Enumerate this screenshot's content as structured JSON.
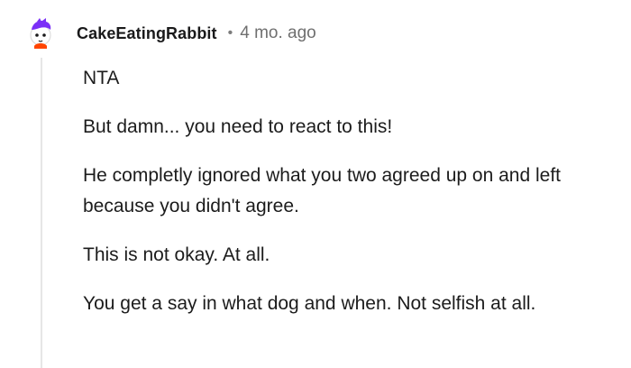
{
  "comment": {
    "username": "CakeEatingRabbit",
    "separator": "•",
    "timestamp": "4 mo. ago",
    "paragraphs": [
      "NTA",
      "But damn... you need to react to this!",
      "He completly ignored what you two agreed up on and left because you didn't agree.",
      "This is not okay. At all.",
      "You get a say in what dog and when. Not selfish at all."
    ]
  },
  "colors": {
    "avatar_hair": "#7b2ff7",
    "avatar_accent": "#ff4500",
    "thread_line": "#e6e6e6",
    "meta_text": "#6f6f6f"
  }
}
